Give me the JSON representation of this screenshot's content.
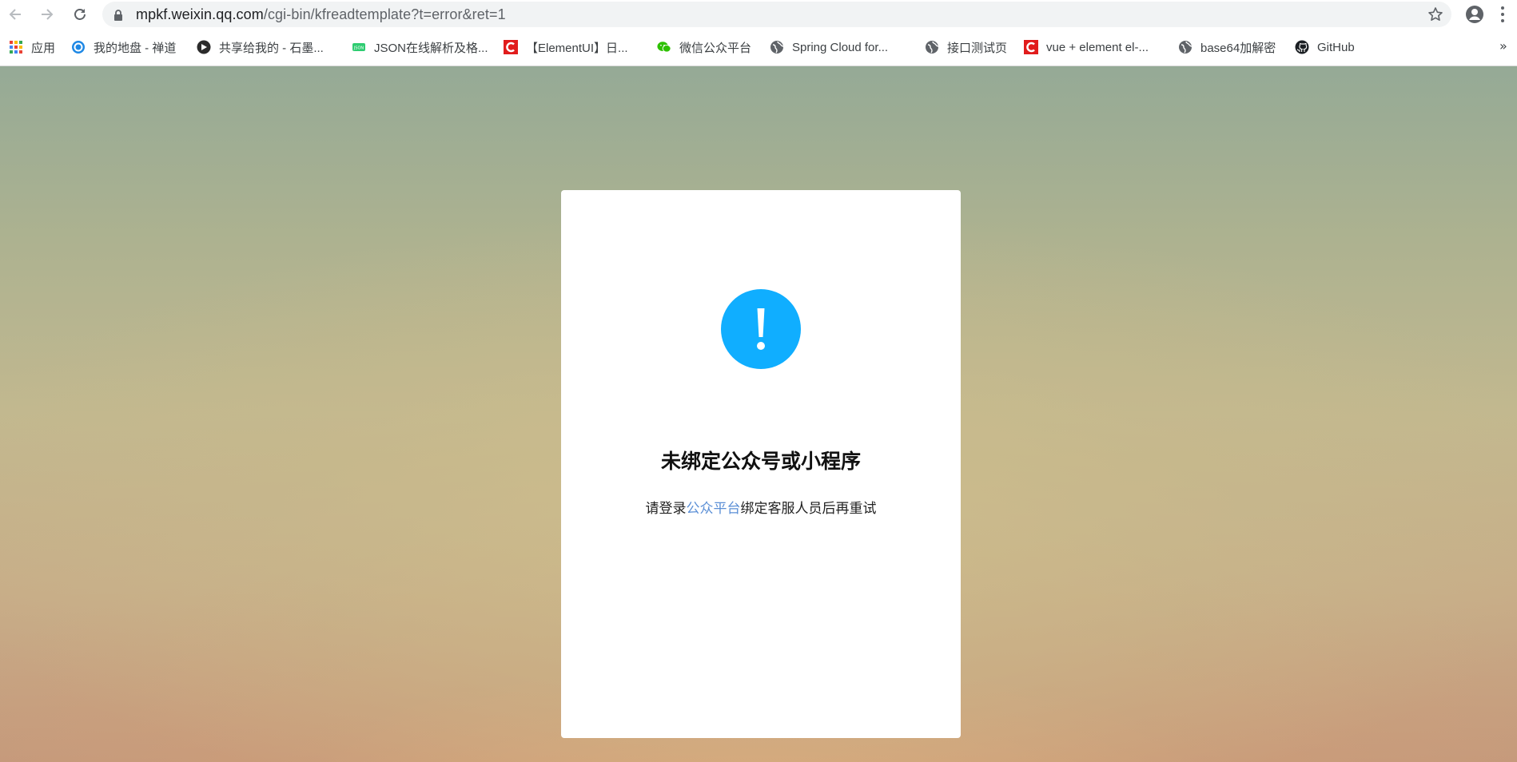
{
  "browser": {
    "url_host": "mpkf.weixin.qq.com",
    "url_path": "/cgi-bin/kfreadtemplate?t=error&ret=1",
    "icons": {
      "back": "back-arrow-icon",
      "forward": "forward-arrow-icon",
      "reload": "reload-icon",
      "lock": "lock-icon",
      "star": "star-icon",
      "profile": "profile-icon",
      "menu": "kebab-menu-icon"
    }
  },
  "bookmarks": {
    "items": [
      {
        "label": "应用",
        "icon": "apps-grid-icon"
      },
      {
        "label": "我的地盘 - 禅道",
        "icon": "zentao-icon"
      },
      {
        "label": "共享给我的 - 石墨...",
        "icon": "shimo-icon"
      },
      {
        "label": "JSON在线解析及格...",
        "icon": "json-icon"
      },
      {
        "label": "【ElementUI】日...",
        "icon": "csdn-icon"
      },
      {
        "label": "微信公众平台",
        "icon": "wechat-icon"
      },
      {
        "label": "Spring Cloud for...",
        "icon": "globe-icon"
      },
      {
        "label": "接口测试页",
        "icon": "globe-icon"
      },
      {
        "label": "vue + element el-...",
        "icon": "csdn-icon"
      },
      {
        "label": "base64加解密",
        "icon": "globe-icon"
      },
      {
        "label": "GitHub",
        "icon": "github-icon"
      }
    ],
    "more": "»"
  },
  "page": {
    "alert_icon": "exclamation-circle-icon",
    "alert_color": "#10aeff",
    "title": "未绑定公众号或小程序",
    "desc_before": "请登录",
    "desc_link": "公众平台",
    "desc_after": "绑定客服人员后再重试",
    "link_color": "#5b8fd6"
  }
}
